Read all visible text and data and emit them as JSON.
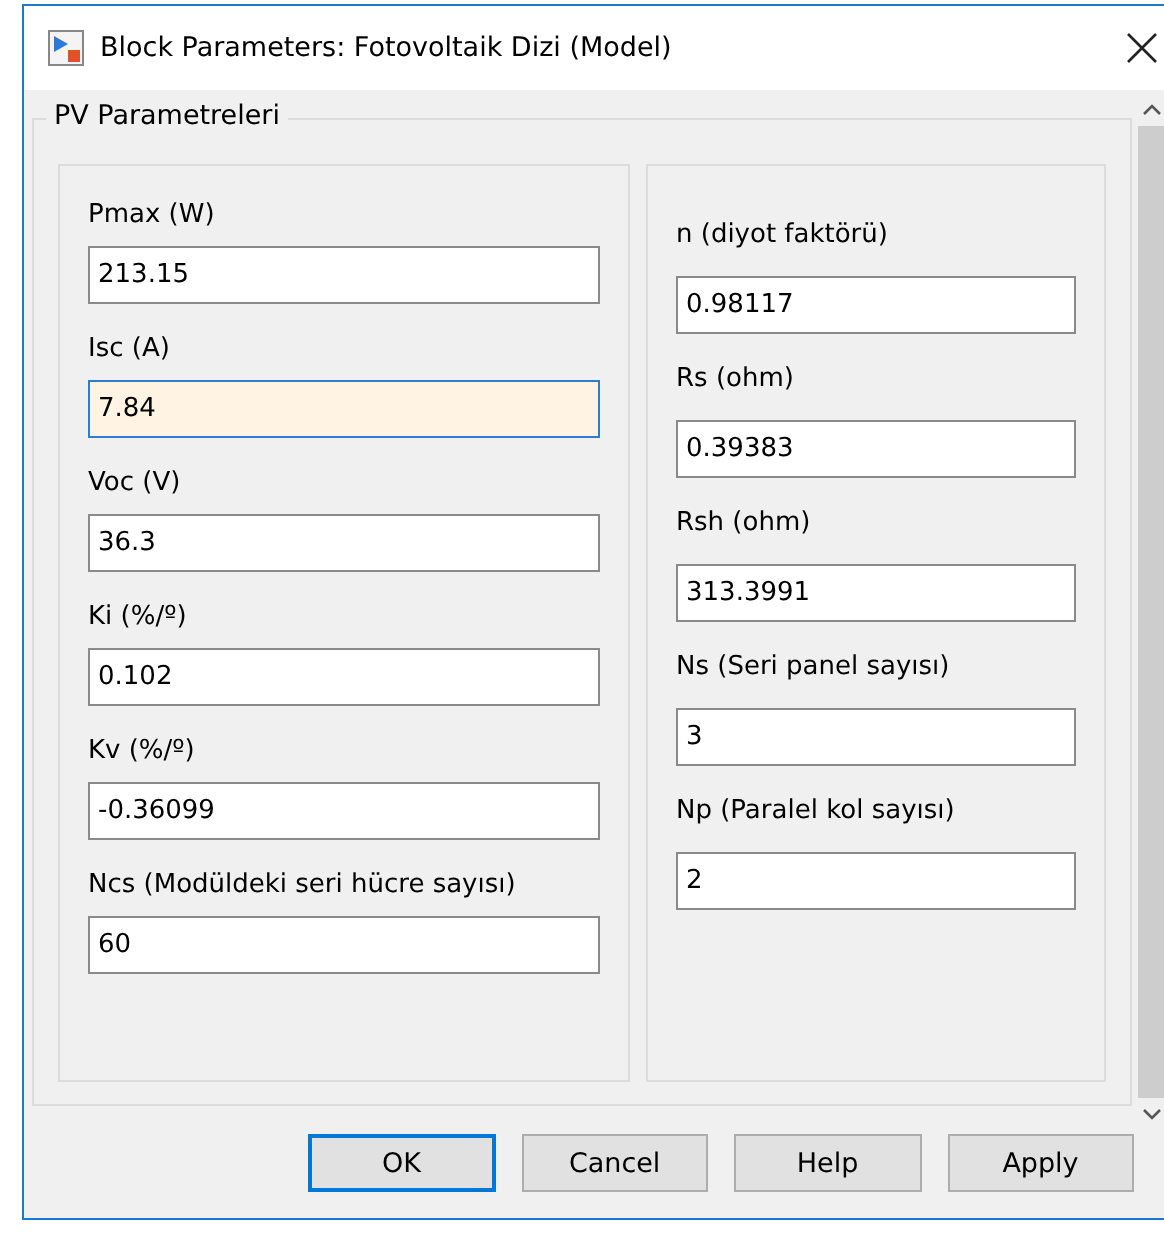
{
  "window": {
    "title": "Block Parameters: Fotovoltaik Dizi (Model)"
  },
  "group": {
    "title": "PV Parametreleri"
  },
  "columns": [
    {
      "fields": [
        {
          "label": "Pmax (W)",
          "value": "213.15",
          "focused": false
        },
        {
          "label": "Isc (A)",
          "value": "7.84",
          "focused": true
        },
        {
          "label": "Voc (V)",
          "value": "36.3",
          "focused": false
        },
        {
          "label": "Ki (%/º)",
          "value": "0.102",
          "focused": false
        },
        {
          "label": "Kv (%/º)",
          "value": "-0.36099",
          "focused": false
        },
        {
          "label": "Ncs (Modüldeki seri hücre sayısı)",
          "value": "60",
          "focused": false
        }
      ]
    },
    {
      "fields": [
        {
          "label": "n (diyot faktörü)",
          "value": "0.98117",
          "focused": false
        },
        {
          "label": "Rs (ohm)",
          "value": "0.39383",
          "focused": false
        },
        {
          "label": "Rsh (ohm)",
          "value": "313.3991",
          "focused": false
        },
        {
          "label": "Ns (Seri panel sayısı)",
          "value": "3",
          "focused": false
        },
        {
          "label": "Np (Paralel kol sayısı)",
          "value": "2",
          "focused": false
        }
      ]
    }
  ],
  "buttons": [
    {
      "label": "OK",
      "default": true
    },
    {
      "label": "Cancel",
      "default": false
    },
    {
      "label": "Help",
      "default": false
    },
    {
      "label": "Apply",
      "default": false
    }
  ]
}
